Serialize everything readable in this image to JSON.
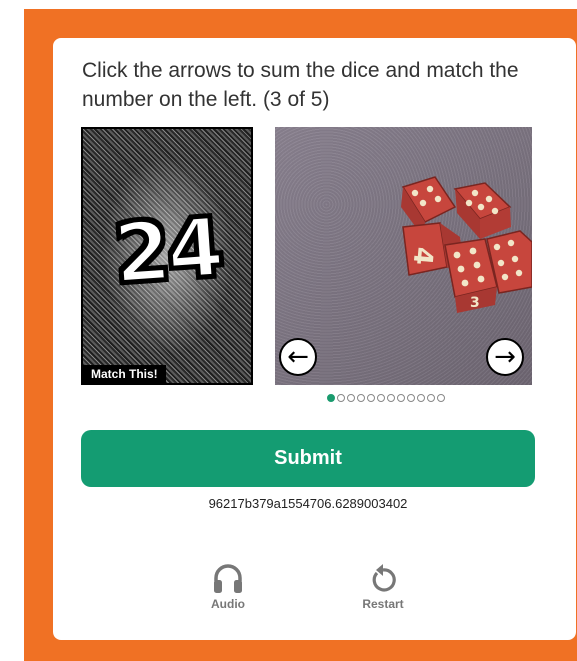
{
  "instruction": "Click the arrows to sum the dice and match the number on the left. (3 of 5)",
  "target": {
    "number": "24",
    "label": "Match This!"
  },
  "dice_viewer": {
    "prev_arrow": "←",
    "next_arrow": "→",
    "total_positions": 12,
    "current_position": 1
  },
  "submit_label": "Submit",
  "session_id": "96217b379a1554706.6289003402",
  "footer": {
    "audio_label": "Audio",
    "restart_label": "Restart"
  },
  "icons": {
    "audio": "headphones-icon",
    "restart": "restart-icon"
  },
  "colors": {
    "frame": "#f07124",
    "submit": "#149c72",
    "active_dot": "#1a9b6e",
    "dice": "#c7463d"
  }
}
